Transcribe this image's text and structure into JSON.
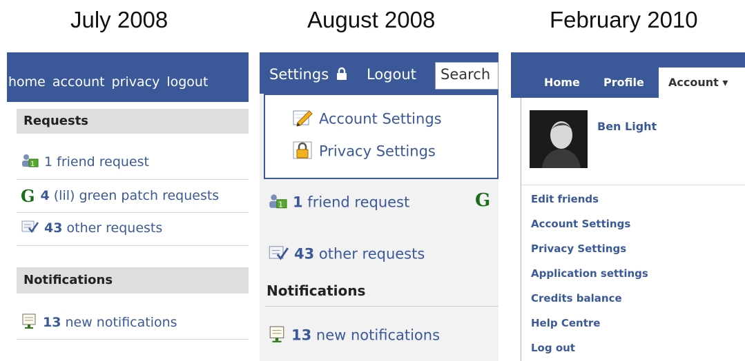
{
  "titles": [
    "July 2008",
    "August 2008",
    "February 2010"
  ],
  "july2008": {
    "nav": [
      "home",
      "account",
      "privacy",
      "logout"
    ],
    "requests": {
      "heading": "Requests",
      "items": [
        {
          "icon": "friend-request-icon",
          "count": "",
          "text": "1 friend request"
        },
        {
          "icon": "green-patch-icon",
          "count": "4",
          "text": " (lil) green patch requests"
        },
        {
          "icon": "other-requests-icon",
          "count": "43",
          "text": " other requests"
        }
      ]
    },
    "notifications": {
      "heading": "Notifications",
      "items": [
        {
          "icon": "notifications-icon",
          "count": "13",
          "text": " new notifications"
        }
      ]
    }
  },
  "aug2008": {
    "nav": {
      "settings": "Settings",
      "logout": "Logout",
      "search_placeholder": "Search"
    },
    "dropdown": [
      {
        "icon": "pencil-icon",
        "label": "Account Settings"
      },
      {
        "icon": "lock-icon",
        "label": "Privacy Settings"
      }
    ],
    "requests": [
      {
        "icon": "friend-request-icon",
        "count": "1",
        "text": " friend request"
      },
      {
        "icon": "other-requests-icon",
        "count": "43",
        "text": " other requests"
      }
    ],
    "green_g": "G",
    "notifications_heading": "Notifications",
    "notifications": {
      "icon": "notifications-icon",
      "count": "13",
      "text": " new notifications"
    }
  },
  "feb2010": {
    "tabs": [
      "Home",
      "Profile"
    ],
    "account_tab": "Account ▾",
    "user_name": "Ben Light",
    "menu": [
      "Edit friends",
      "Account Settings",
      "Privacy Settings",
      "Application settings",
      "Credits balance",
      "Help Centre",
      "Log out"
    ]
  },
  "colors": {
    "brand": "#3b5998",
    "link": "#3b5998",
    "green": "#1a6e1a"
  }
}
